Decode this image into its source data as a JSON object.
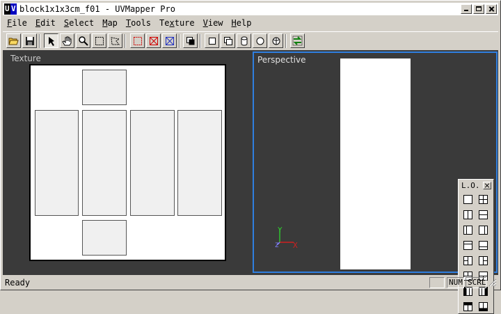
{
  "window": {
    "icon_u": "U",
    "icon_v": "V",
    "title": "block1x1x3cm_f01 - UVMapper Pro"
  },
  "menu": [
    {
      "ul": "F",
      "rest": "ile"
    },
    {
      "ul": "E",
      "rest": "dit"
    },
    {
      "ul": "S",
      "rest": "elect"
    },
    {
      "ul": "M",
      "rest": "ap"
    },
    {
      "ul": "T",
      "rest": "ools"
    },
    {
      "ul": "",
      "pre": "Te",
      "ul2": "x",
      "rest": "ture"
    },
    {
      "ul": "V",
      "rest": "iew"
    },
    {
      "ul": "H",
      "rest": "elp"
    }
  ],
  "menu_labels": [
    "File",
    "Edit",
    "Select",
    "Map",
    "Tools",
    "Texture",
    "View",
    "Help"
  ],
  "toolbar_icons": [
    "open-folder-icon",
    "save-icon",
    "select-arrow-icon",
    "pan-hand-icon",
    "zoom-icon",
    "rect-select-icon",
    "lasso-select-icon",
    "select-red-icon",
    "deselect-red-icon",
    "deselect-blue-icon",
    "copy-icon",
    "box-view-icon",
    "two-box-view-icon",
    "cylinder-view-icon",
    "sphere-view-icon",
    "hemisphere-view-icon",
    "swap-green-icon"
  ],
  "texture_pane": {
    "label": "Texture"
  },
  "perspective_pane": {
    "label": "Perspective",
    "axis_x": "X",
    "axis_y": "Y",
    "axis_z": "Z"
  },
  "layout_panel": {
    "title": "L.O."
  },
  "status": {
    "text": "Ready",
    "num": "NUM",
    "scrl": "SCRL"
  },
  "colors": {
    "workspace_bg": "#3a3a3a",
    "active_view_border": "#2f7fe0",
    "chrome": "#d4d0c8"
  }
}
